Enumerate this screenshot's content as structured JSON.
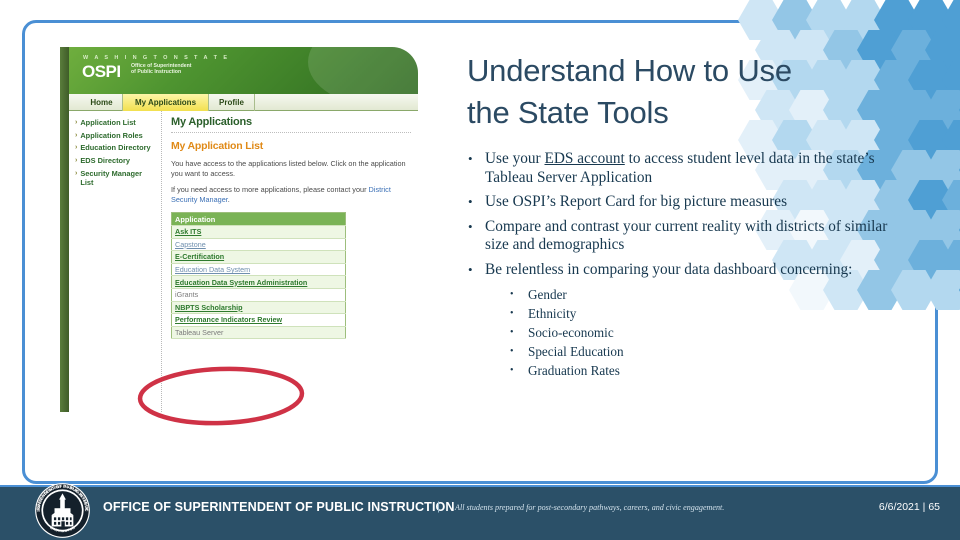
{
  "slide": {
    "title": "Understand How to Use the State Tools",
    "title_line1": "Understand How to Use",
    "title_line2": "the State Tools",
    "accent_color": "#4a8fd4",
    "title_color": "#2b4a63"
  },
  "bullets": [
    {
      "pre": "Use your ",
      "underlined": "EDS account",
      "post": " to access student level data in the state’s Tableau Server Application"
    },
    {
      "pre": "Use OSPI’s Report Card for big picture measures",
      "underlined": "",
      "post": ""
    },
    {
      "pre": "Compare and contrast your current reality with districts of similar size and demographics",
      "underlined": "",
      "post": ""
    },
    {
      "pre": "Be relentless in comparing your data dashboard concerning:",
      "underlined": "",
      "post": ""
    }
  ],
  "sub_bullets": [
    "Gender",
    "Ethnicity",
    "Socio-economic",
    "Special Education",
    "Graduation Rates"
  ],
  "screenshot": {
    "brand": {
      "state": "W A S H I N G T O N     S T A T E",
      "acronym": "OSPI",
      "sub_line1": "Office of Superintendent",
      "sub_line2": "of Public Instruction"
    },
    "tabs": [
      {
        "label": "Home",
        "selected": false
      },
      {
        "label": "My Applications",
        "selected": true
      },
      {
        "label": "Profile",
        "selected": false
      }
    ],
    "sidebar": [
      "Application List",
      "Application Roles",
      "Education Directory",
      "EDS Directory",
      "Security Manager List"
    ],
    "heading": "My Applications",
    "subheading": "My Application List",
    "paragraph1": "You have access to the applications listed below. Click on the application you want to access.",
    "paragraph2_pre": "If you need access to more applications, please contact your ",
    "paragraph2_link": "District Security Manager",
    "paragraph2_post": ".",
    "table_header": "Application",
    "applications": [
      {
        "name": "Ask ITS",
        "style": "lnk"
      },
      {
        "name": "Capstone",
        "style": "dimlnk"
      },
      {
        "name": "E-Certification",
        "style": "lnk"
      },
      {
        "name": "Education Data System",
        "style": "dimlnk"
      },
      {
        "name": "Education Data System Administration",
        "style": "lnk"
      },
      {
        "name": "iGrants",
        "style": "dim"
      },
      {
        "name": "NBPTS Scholarship",
        "style": "lnk"
      },
      {
        "name": "Performance Indicators Review",
        "style": "lnk"
      },
      {
        "name": "Tableau Server",
        "style": "dim"
      }
    ],
    "annotation": "red-ellipse-highlight"
  },
  "footer": {
    "organization": "OFFICE OF SUPERINTENDENT OF PUBLIC INSTRUCTION",
    "divider": "|",
    "tagline": "All students prepared for post-secondary pathways, careers, and civic engagement.",
    "date": "6/6/2021",
    "page_divider": "|",
    "page_number": "65",
    "background_color": "#2b5068"
  }
}
